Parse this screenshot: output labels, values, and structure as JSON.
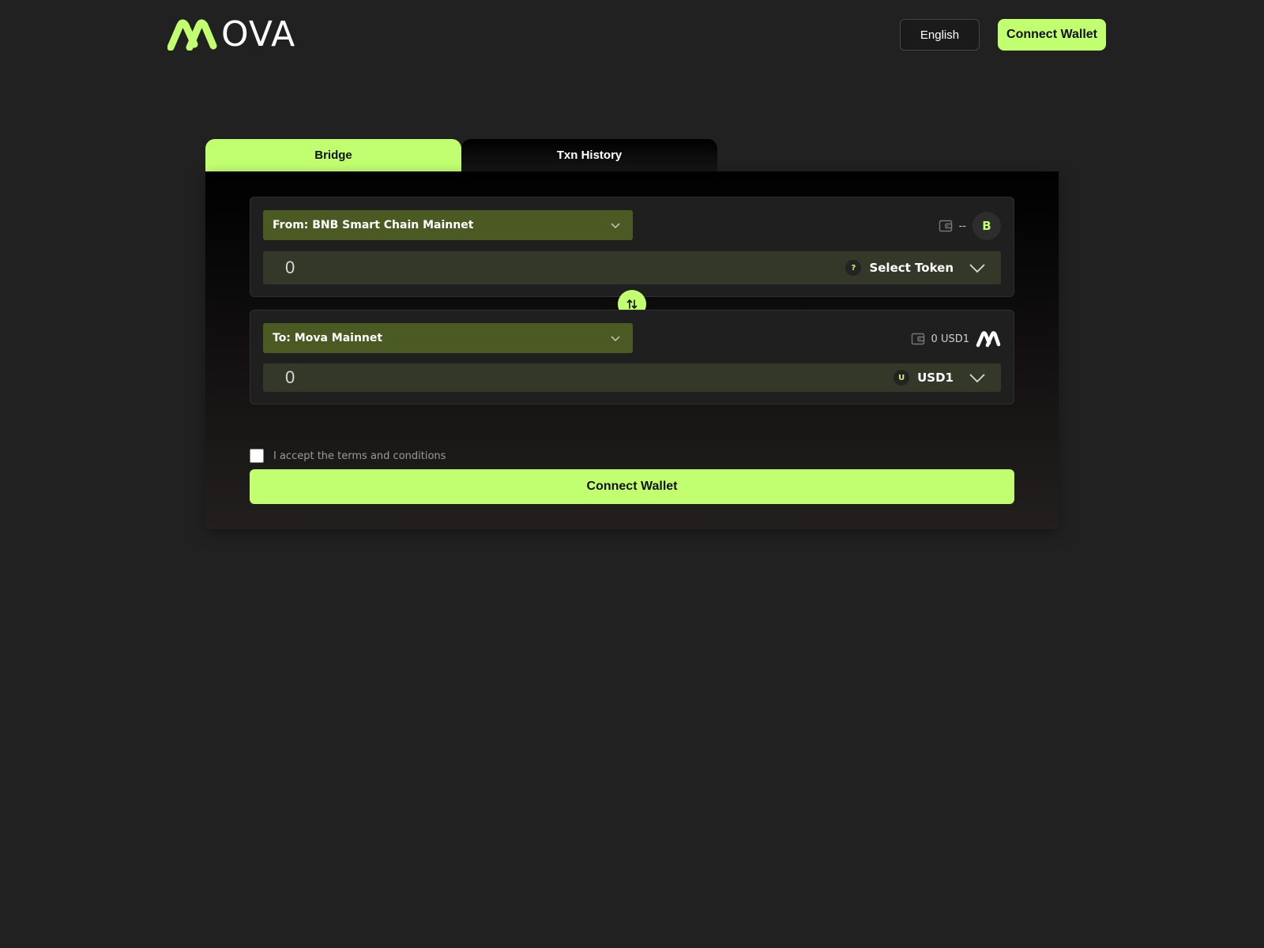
{
  "header": {
    "logo_text": "OVA",
    "language_label": "English",
    "connect_wallet_label": "Connect Wallet"
  },
  "tabs": [
    {
      "label": "Bridge",
      "active": true
    },
    {
      "label": "Txn History",
      "active": false
    }
  ],
  "from": {
    "chain_label": "From: BNB Smart Chain Mainnet",
    "balance": "--",
    "chain_badge": "B",
    "amount": "0",
    "token_badge": "?",
    "token_label": "Select Token"
  },
  "to": {
    "chain_label": "To: Mova Mainnet",
    "balance": "0 USD1",
    "amount": "0",
    "token_badge": "U",
    "token_label": "USD1"
  },
  "terms_label": "I accept the terms and conditions",
  "main_button_label": "Connect Wallet",
  "colors": {
    "accent": "#c2ff70",
    "background": "#212121",
    "chain_select_bg": "#4a5a22",
    "amount_row_bg": "#333829"
  },
  "icons": {
    "logo": "mova-logo-icon",
    "chevron": "chevron-down-icon",
    "wallet": "wallet-icon",
    "swap": "swap-arrows-icon",
    "mova_chain": "mova-logo-icon"
  }
}
